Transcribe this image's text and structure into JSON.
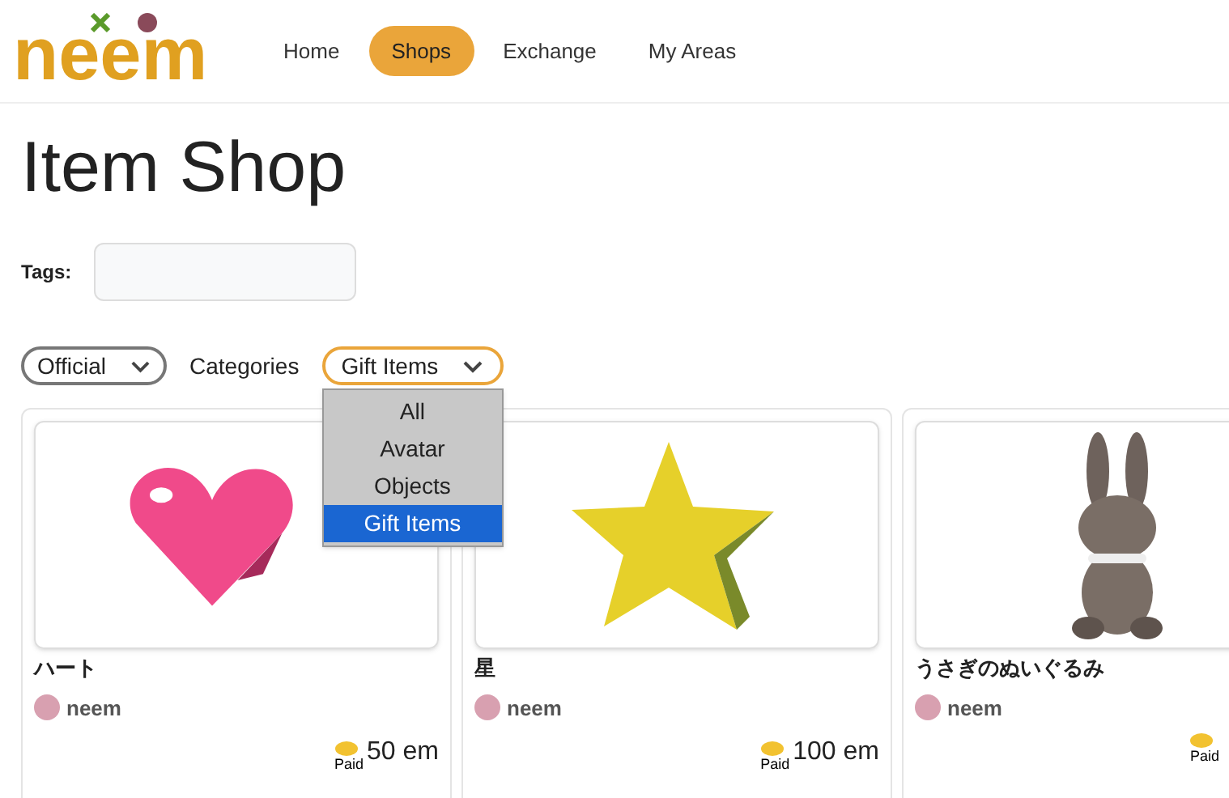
{
  "logo": {
    "text": "neem"
  },
  "nav": [
    {
      "label": "Home",
      "selected": false
    },
    {
      "label": "Shops",
      "selected": true
    },
    {
      "label": "Exchange",
      "selected": false
    },
    {
      "label": "My Areas",
      "selected": false
    }
  ],
  "title": "Item Shop",
  "tags": {
    "label": "Tags:"
  },
  "filters": {
    "source": {
      "value": "Official"
    },
    "categories_label": "Categories",
    "category": {
      "value": "Gift Items",
      "expanded": true,
      "options": [
        {
          "label": "All",
          "selected": false
        },
        {
          "label": "Avatar",
          "selected": false
        },
        {
          "label": "Objects",
          "selected": false
        },
        {
          "label": "Gift Items",
          "selected": true
        }
      ]
    }
  },
  "items": [
    {
      "kind": "heart",
      "name": "ハート",
      "creator": "neem",
      "paid_label": "Paid",
      "price": "50 em"
    },
    {
      "kind": "star",
      "name": "星",
      "creator": "neem",
      "paid_label": "Paid",
      "price": "100 em"
    },
    {
      "kind": "rabbit",
      "name": "うさぎのぬいぐるみ",
      "creator": "neem",
      "paid_label": "Paid"
    }
  ]
}
